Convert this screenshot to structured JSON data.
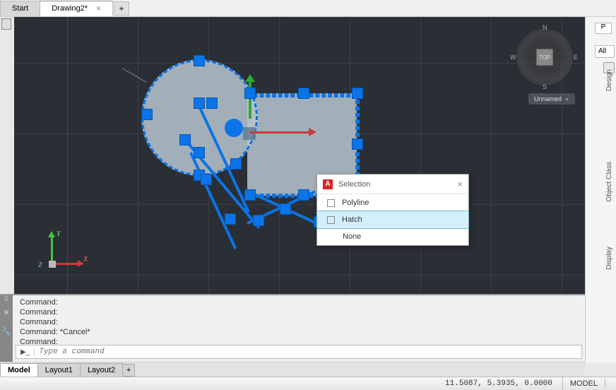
{
  "tabs": {
    "start": "Start",
    "drawing": "Drawing2*"
  },
  "compass": {
    "n": "N",
    "s": "S",
    "e": "E",
    "w": "W",
    "top": "TOP"
  },
  "viewcube_menu": "Unnamed",
  "selection_popup": {
    "title": "Selection",
    "items": [
      "Polyline",
      "Hatch",
      "None"
    ]
  },
  "ucs": {
    "x": "X",
    "y": "Y",
    "z": "Z"
  },
  "command_lines": [
    "Command:",
    "Command:",
    "Command:",
    "Command: *Cancel*",
    "Command:"
  ],
  "command_placeholder": "Type a command",
  "layout_tabs": {
    "model": "Model",
    "l1": "Layout1",
    "l2": "Layout2"
  },
  "status": {
    "coords": "11.5087, 5.3935, 0.0000",
    "model": "MODEL"
  },
  "right_panel": {
    "p": "P",
    "all": "All",
    "design": "Design",
    "object_class": "Object Class",
    "display": "Display"
  }
}
